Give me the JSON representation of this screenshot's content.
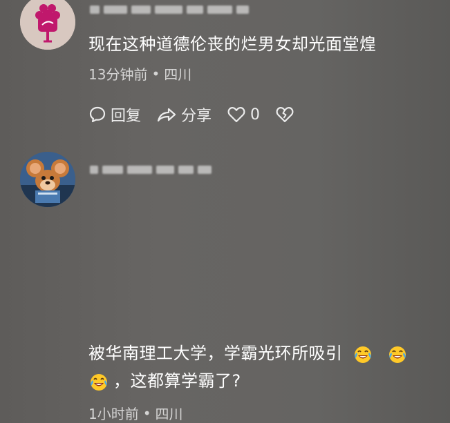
{
  "comments": [
    {
      "text": "现在这种道德伦丧的烂男女却光面堂煌",
      "time": "13分钟前",
      "separator": "•",
      "location": "四川",
      "actions": {
        "reply_label": "回复",
        "share_label": "分享",
        "like_count": "0"
      }
    },
    {
      "text_part1": "被华南理工大学，学霸光环所吸引",
      "text_part2": "，这都算学霸了?",
      "time": "1小时前",
      "separator": "•",
      "location": "四川"
    }
  ],
  "icons": {
    "reply": "comment-bubble-icon",
    "share": "share-arrow-icon",
    "like": "heart-icon",
    "dislike": "broken-heart-icon",
    "emoji": "laughing-crying-emoji-icon"
  },
  "colors": {
    "background": "#646260",
    "text": "#ffffff",
    "muted_text": "#c9c8c6",
    "avatar1_bg": "#d8c8c0",
    "avatar1_logo": "#c0186c",
    "avatar2_bg": "#3a5f8c"
  }
}
